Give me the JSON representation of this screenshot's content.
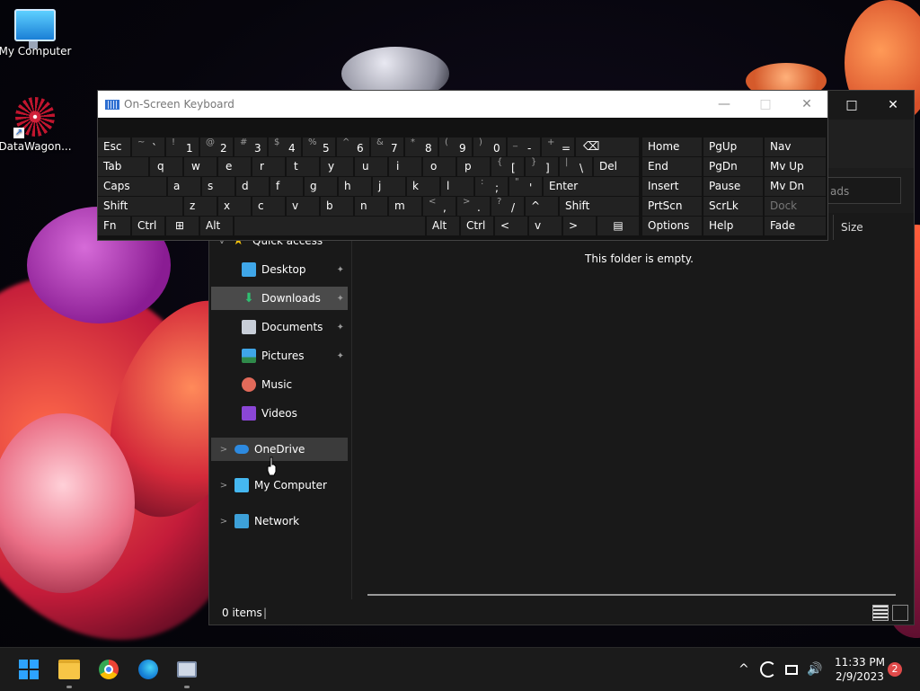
{
  "desktop": {
    "icons": [
      {
        "label": "My Computer"
      },
      {
        "label": "DataWagon..."
      }
    ]
  },
  "explorer": {
    "controls": {
      "maximize": "□",
      "close": "✕"
    },
    "search_placeholder": "ads",
    "column_size": "Size",
    "nav": {
      "quick_access": "Quick access",
      "items": [
        {
          "label": "Desktop",
          "pinned": true
        },
        {
          "label": "Downloads",
          "pinned": true
        },
        {
          "label": "Documents",
          "pinned": true
        },
        {
          "label": "Pictures",
          "pinned": true
        },
        {
          "label": "Music"
        },
        {
          "label": "Videos"
        }
      ],
      "onedrive": "OneDrive",
      "my_computer": "My Computer",
      "network": "Network"
    },
    "empty_message": "This folder is empty.",
    "status": {
      "count": "0 items",
      "separator": "|"
    }
  },
  "osk": {
    "title": "On-Screen Keyboard",
    "controls": {
      "minimize": "—",
      "restore": "□",
      "close": "✕"
    },
    "row1": {
      "esc": "Esc",
      "keys": [
        {
          "sh": "~",
          "mn": "`"
        },
        {
          "sh": "!",
          "mn": "1"
        },
        {
          "sh": "@",
          "mn": "2"
        },
        {
          "sh": "#",
          "mn": "3"
        },
        {
          "sh": "$",
          "mn": "4"
        },
        {
          "sh": "%",
          "mn": "5"
        },
        {
          "sh": "^",
          "mn": "6"
        },
        {
          "sh": "&",
          "mn": "7"
        },
        {
          "sh": "*",
          "mn": "8"
        },
        {
          "sh": "(",
          "mn": "9"
        },
        {
          "sh": ")",
          "mn": "0"
        },
        {
          "sh": "_",
          "mn": "-"
        },
        {
          "sh": "+",
          "mn": "="
        }
      ],
      "backspace": "⌫"
    },
    "row2": {
      "tab": "Tab",
      "letters": [
        "q",
        "w",
        "e",
        "r",
        "t",
        "y",
        "u",
        "i",
        "o",
        "p"
      ],
      "brackets": [
        {
          "sh": "{",
          "mn": "["
        },
        {
          "sh": "}",
          "mn": "]"
        },
        {
          "sh": "|",
          "mn": "\\"
        }
      ],
      "del": "Del"
    },
    "row3": {
      "caps": "Caps",
      "letters": [
        "a",
        "s",
        "d",
        "f",
        "g",
        "h",
        "j",
        "k",
        "l"
      ],
      "punct": [
        {
          "sh": ":",
          "mn": ";"
        },
        {
          "sh": "\"",
          "mn": "'"
        }
      ],
      "enter": "Enter"
    },
    "row4": {
      "shift_left": "Shift",
      "letters": [
        "z",
        "x",
        "c",
        "v",
        "b",
        "n",
        "m"
      ],
      "punct": [
        {
          "sh": "<",
          "mn": ","
        },
        {
          "sh": ">",
          "mn": "."
        },
        {
          "sh": "?",
          "mn": "/"
        }
      ],
      "up": "^",
      "shift_right": "Shift"
    },
    "row5": {
      "fn": "Fn",
      "ctrl_left": "Ctrl",
      "win": "⊞",
      "alt_left": "Alt",
      "alt_right": "Alt",
      "ctrl_right": "Ctrl",
      "left": "<",
      "down": "v",
      "right": ">",
      "menu": "▤"
    },
    "nav_keys": {
      "home": "Home",
      "pgup": "PgUp",
      "nav": "Nav",
      "end": "End",
      "pgdn": "PgDn",
      "mvup": "Mv Up",
      "insert": "Insert",
      "pause": "Pause",
      "mvdn": "Mv Dn",
      "prtscn": "PrtScn",
      "scrlk": "ScrLk",
      "dock": "Dock",
      "options": "Options",
      "help": "Help",
      "fade": "Fade"
    }
  },
  "taskbar": {
    "tray": {
      "chevron": "^",
      "speaker": "🔊"
    },
    "time": "11:33 PM",
    "date": "2/9/2023",
    "notifications": "2"
  }
}
